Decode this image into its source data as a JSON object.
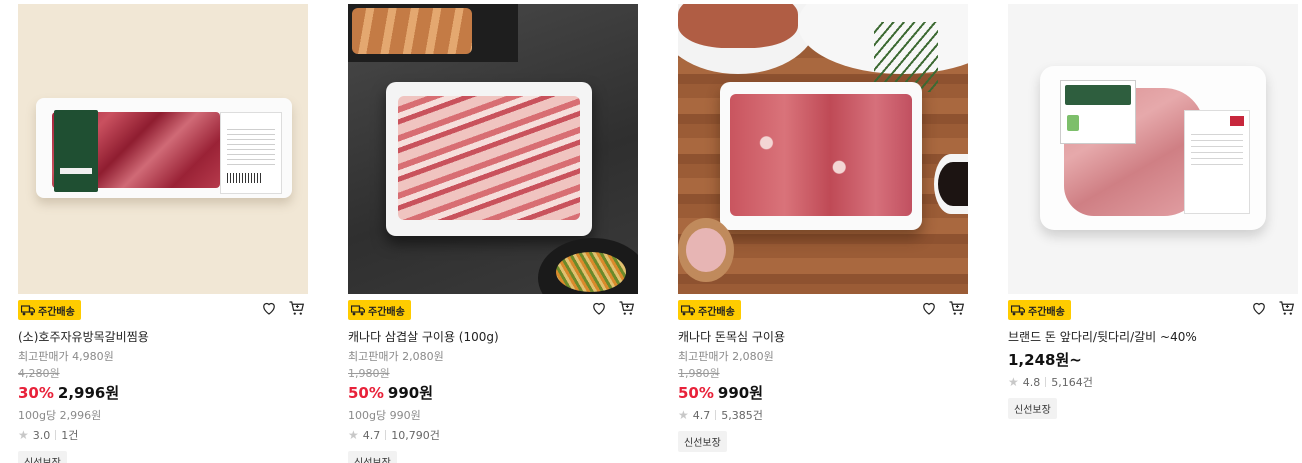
{
  "products": [
    {
      "delivery_tag": "주간배송",
      "name": "(소)호주자유방목갈비찜용",
      "reference_price": "최고판매가 4,980원",
      "original_price": "4,280원",
      "discount": "30%",
      "price": "2,996원",
      "unit_price": "100g당 2,996원",
      "rating": "3.0",
      "review_count": "1건",
      "badge": "신선보장"
    },
    {
      "delivery_tag": "주간배송",
      "name": "캐나다 삼겹살 구이용 (100g)",
      "reference_price": "최고판매가 2,080원",
      "original_price": "1,980원",
      "discount": "50%",
      "price": "990원",
      "unit_price": "100g당 990원",
      "rating": "4.7",
      "review_count": "10,790건",
      "badge": "신선보장"
    },
    {
      "delivery_tag": "주간배송",
      "name": "캐나다 돈목심 구이용",
      "reference_price": "최고판매가 2,080원",
      "original_price": "1,980원",
      "discount": "50%",
      "price": "990원",
      "rating": "4.7",
      "review_count": "5,385건",
      "badge": "신선보장"
    },
    {
      "delivery_tag": "주간배송",
      "name": "브랜드 돈 앞다리/뒷다리/갈비 ~40%",
      "price": "1,248원~",
      "rating": "4.8",
      "review_count": "5,164건",
      "badge": "신선보장"
    }
  ],
  "icons": {
    "wishlist": "heart-icon",
    "cart": "cart-icon",
    "delivery": "truck-icon",
    "rating": "star-icon"
  },
  "colors": {
    "delivery_tag_bg": "#ffcc00",
    "discount_red": "#e8223a"
  }
}
